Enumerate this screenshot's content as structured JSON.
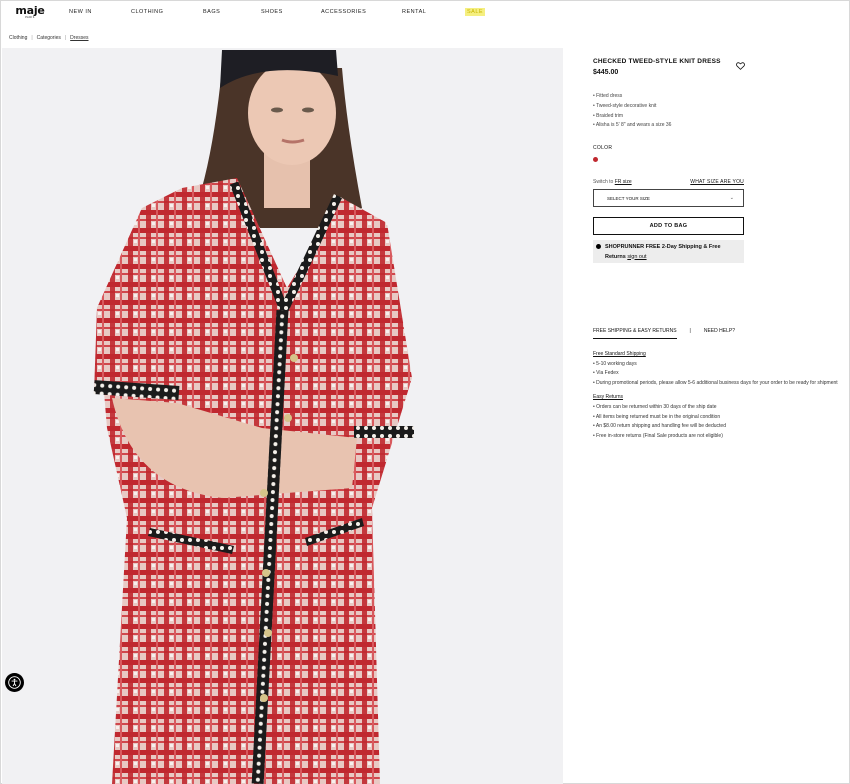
{
  "header": {
    "logo": "maje",
    "logo_sub": "PARIS",
    "nav": [
      {
        "label": "NEW IN"
      },
      {
        "label": "CLOTHING"
      },
      {
        "label": "BAGS"
      },
      {
        "label": "SHOES"
      },
      {
        "label": "ACCESSORIES"
      },
      {
        "label": "RENTAL"
      },
      {
        "label": "SALE"
      }
    ]
  },
  "breadcrumb": {
    "items": [
      "Clothing",
      "Categories",
      "Dresses"
    ],
    "separator": "|"
  },
  "product": {
    "title": "CHECKED TWEED-STYLE KNIT DRESS",
    "price": "$445.00",
    "features": [
      "Fitted dress",
      "Tweed-style decorative knit",
      "Braided trim",
      "Alisha is 5' 8\" and wears a size 36"
    ],
    "color_label": "COLOR",
    "color_swatch": "#c0282f",
    "size_switch_prefix": "Switch to",
    "size_switch_link": "FR size",
    "what_size": "WHAT SIZE ARE YOU",
    "size_select": "SELECT YOUR SIZE",
    "add_to_bag": "ADD TO BAG",
    "shoprunner_text": "SHOPRUNNER FREE 2-Day Shipping & Free",
    "shoprunner_returns": "Returns",
    "shoprunner_signout": "sign out"
  },
  "tabs": {
    "active": "FREE SHIPPING & EASY RETURNS",
    "separator": "|",
    "help": "NEED HELP?"
  },
  "shipping": {
    "standard_heading": "Free Standard Shipping",
    "standard_items": [
      "5-10 working days",
      "Via Fedex",
      "During promotional periods, please allow 5-6 additional business days for your order to be ready for shipment"
    ],
    "returns_heading": "Easy Returns",
    "returns_items": [
      "Orders can be returned within 30 days of the ship date",
      "All items being returned must be in the original condition",
      "An $8.00 return shipping and handling fee will be deducted",
      "Free in-store returns (Final Sale products are not eligible)"
    ]
  },
  "icons": {
    "wishlist": "heart-icon",
    "size_dropdown": "chevron-down-icon",
    "accessibility": "accessibility-icon",
    "shoprunner": "shoprunner-icon"
  },
  "colors": {
    "accent_sale": "#f5ef80",
    "dress_red": "#c0282f",
    "swatch": "#c0282f"
  }
}
